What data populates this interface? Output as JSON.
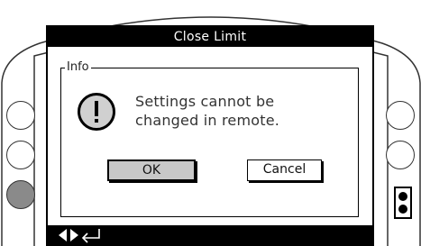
{
  "title_bar": {
    "title": "Close Limit"
  },
  "dialog": {
    "group_label": "Info",
    "icon": "exclamation-icon",
    "message_lines": [
      "Settings cannot be",
      "changed in remote."
    ],
    "buttons": {
      "ok": "OK",
      "cancel": "Cancel"
    },
    "default_button": "ok"
  },
  "bottom_bar": {
    "icons": [
      "left-right-arrows-icon",
      "enter-icon"
    ]
  },
  "colors": {
    "bar_background": "#000000",
    "selected_button": "#c8c8c8",
    "active_side_button": "#8a8a8a"
  }
}
